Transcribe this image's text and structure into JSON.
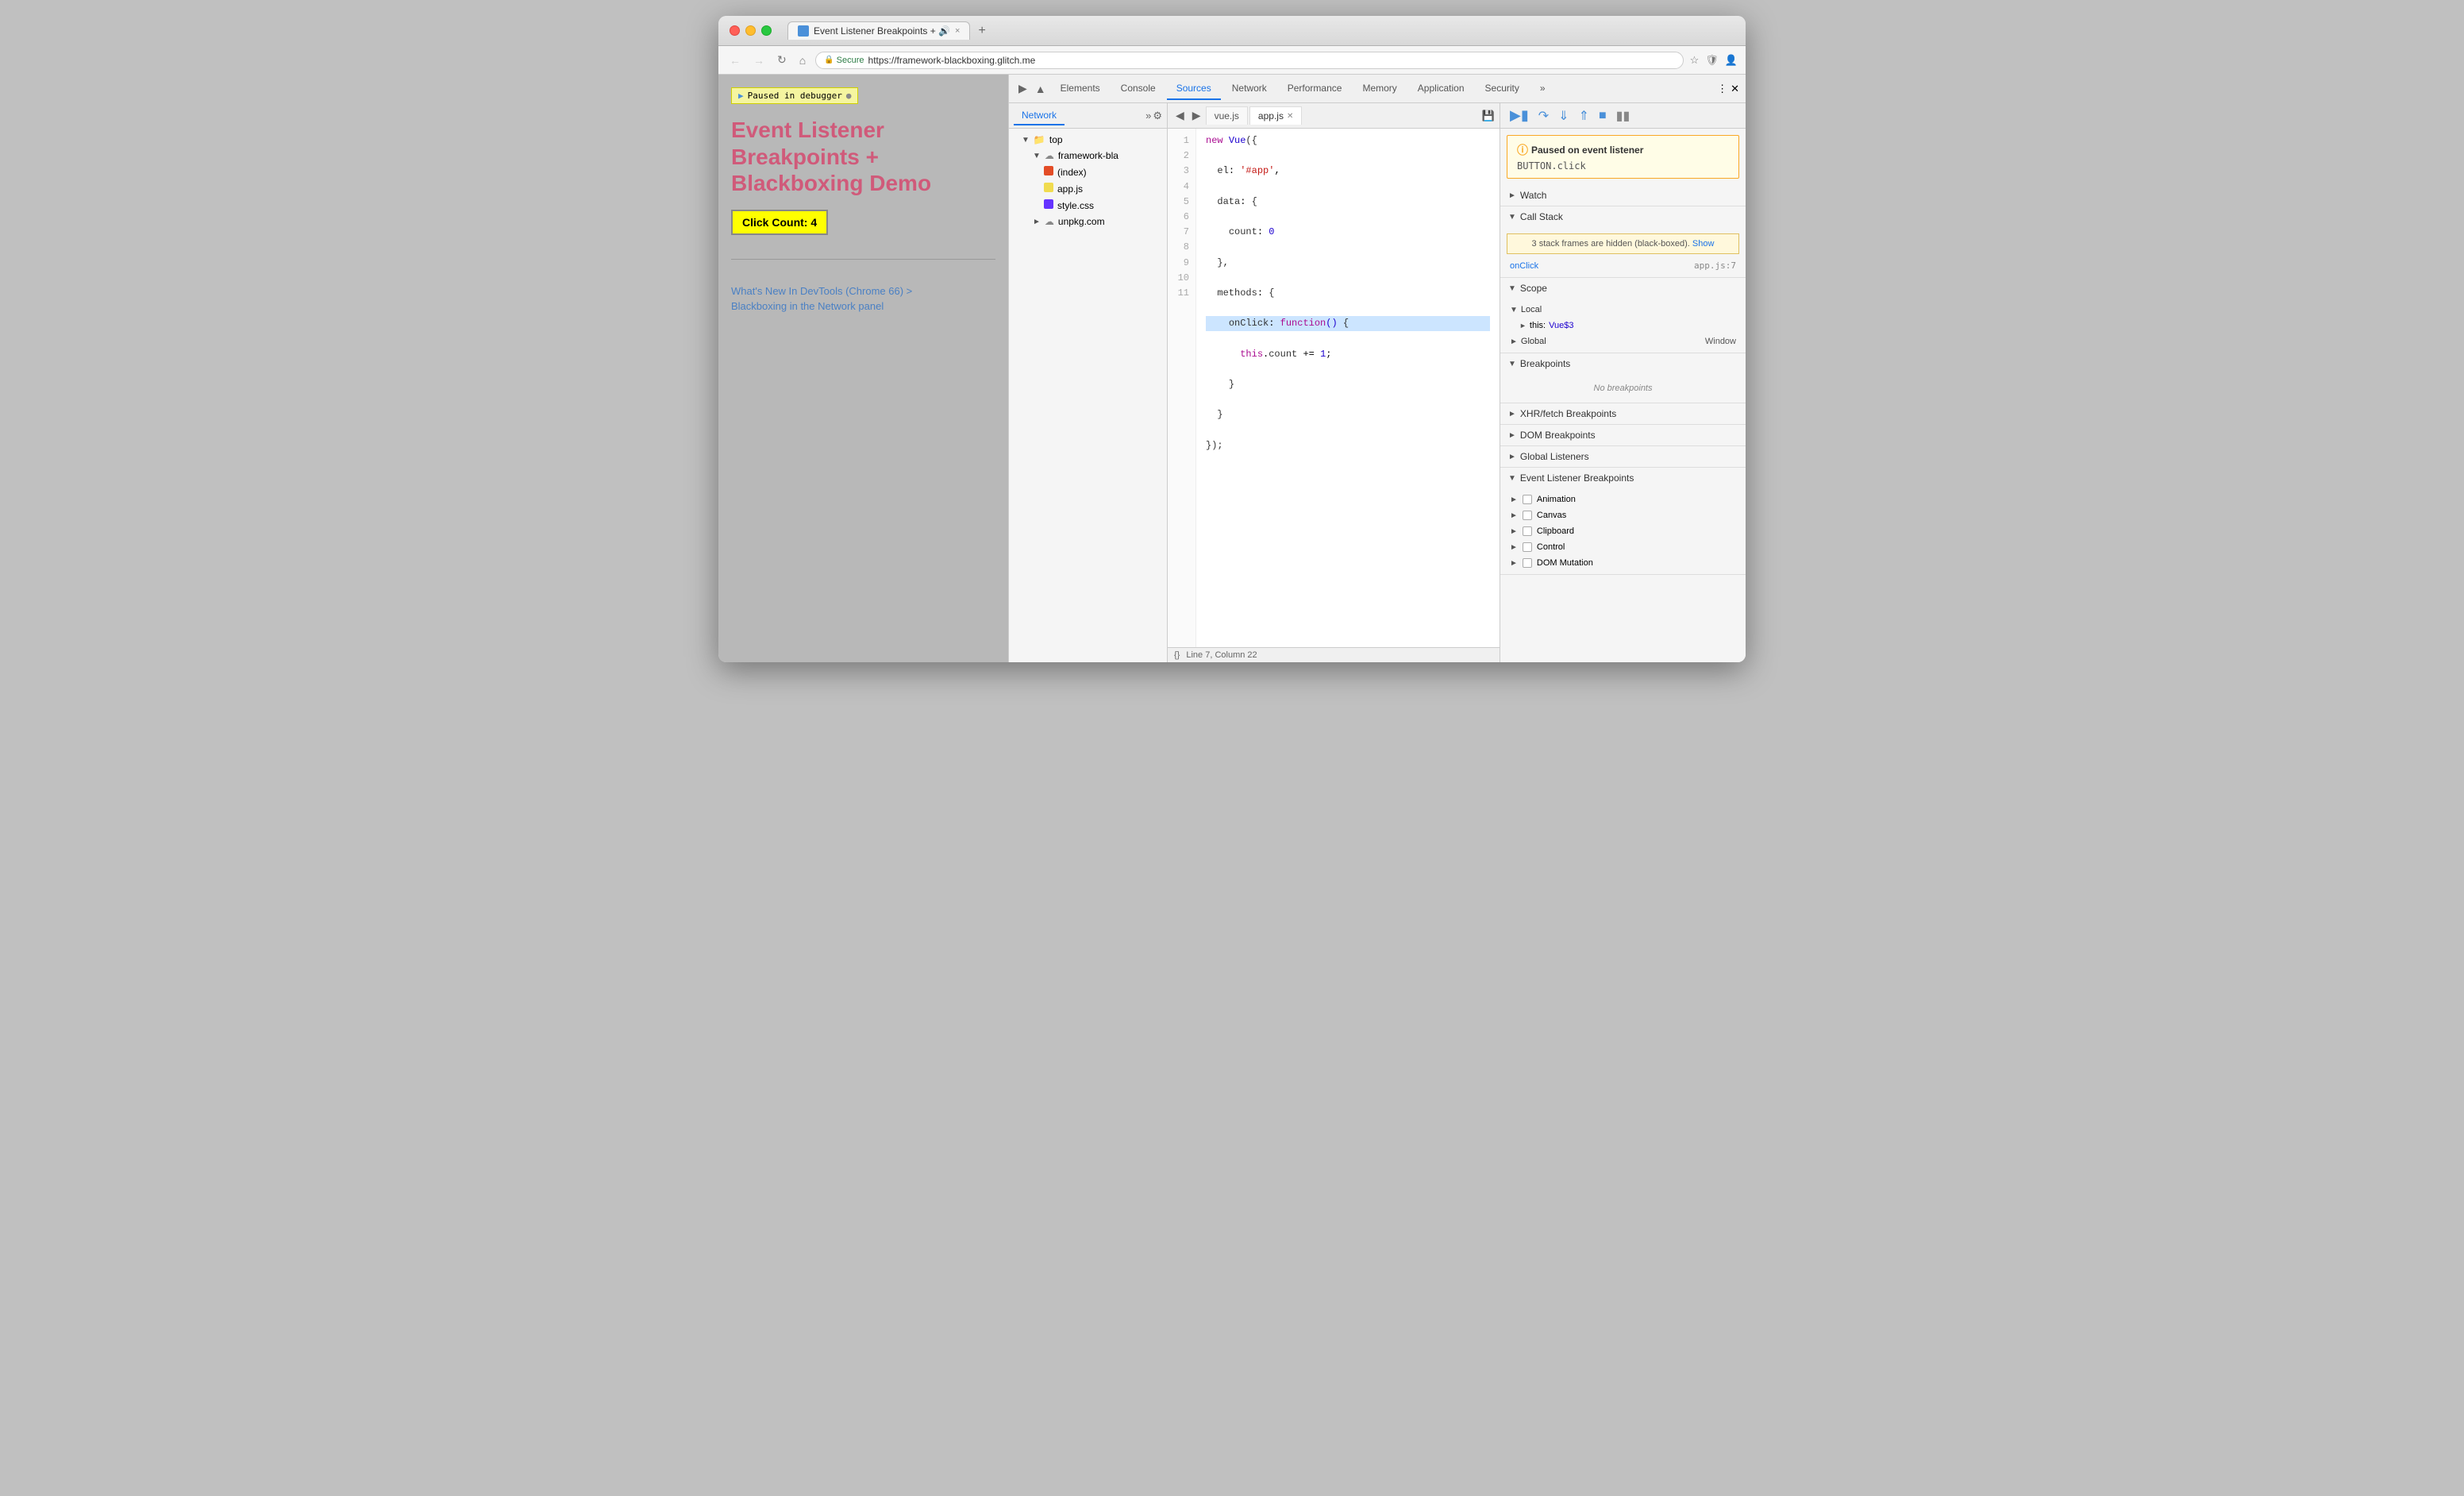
{
  "browser": {
    "tab_title": "Event Listener Breakpoints + 🔊",
    "tab_close": "×",
    "url_secure": "Secure",
    "url": "https://framework-blackboxing.glitch.me",
    "new_tab": "+"
  },
  "page_preview": {
    "paused_badge": "Paused in debugger",
    "title_line1": "Event Listener",
    "title_line2": "Breakpoints +",
    "title_line3": "Blackboxing Demo",
    "click_count": "Click Count: 4",
    "link1": "What's New In DevTools (Chrome 66) >",
    "link2": "Blackboxing in the Network panel"
  },
  "devtools": {
    "tabs": [
      "Elements",
      "Console",
      "Sources",
      "Network",
      "Performance",
      "Memory",
      "Application",
      "Security"
    ],
    "active_tab": "Sources"
  },
  "sources_sidebar": {
    "tabs": [
      "Network"
    ],
    "tree": [
      {
        "label": "top",
        "type": "root",
        "indent": 0
      },
      {
        "label": "framework-bla",
        "type": "cloud",
        "indent": 1
      },
      {
        "label": "(index)",
        "type": "html",
        "indent": 2
      },
      {
        "label": "app.js",
        "type": "js",
        "indent": 2
      },
      {
        "label": "style.css",
        "type": "css",
        "indent": 2
      },
      {
        "label": "unpkg.com",
        "type": "cloud",
        "indent": 1
      }
    ]
  },
  "editor": {
    "tabs": [
      "vue.js",
      "app.js"
    ],
    "active_tab": "app.js",
    "code_lines": [
      {
        "n": 1,
        "code": "new Vue({"
      },
      {
        "n": 2,
        "code": "  el: '#app',"
      },
      {
        "n": 3,
        "code": "  data: {"
      },
      {
        "n": 4,
        "code": "    count: 0"
      },
      {
        "n": 5,
        "code": "  },"
      },
      {
        "n": 6,
        "code": "  methods: {"
      },
      {
        "n": 7,
        "code": "    onClick: function() {",
        "active": true
      },
      {
        "n": 8,
        "code": "      this.count += 1;"
      },
      {
        "n": 9,
        "code": "    }"
      },
      {
        "n": 10,
        "code": "  }"
      },
      {
        "n": 11,
        "code": "});"
      }
    ],
    "status_bar": "Line 7, Column 22",
    "pretty_print": "{}"
  },
  "right_panel": {
    "paused_notice_title": "Paused on event listener",
    "paused_notice_detail": "BUTTON.click",
    "sections": {
      "watch_label": "Watch",
      "callstack_label": "Call Stack",
      "callstack_warning": "3 stack frames are hidden (black-boxed).",
      "callstack_warning_link": "Show",
      "stack_item_fn": "onClick",
      "stack_item_loc": "app.js:7",
      "scope_label": "Scope",
      "local_label": "Local",
      "this_val": "Vue$3",
      "global_label": "Global",
      "global_val": "Window",
      "breakpoints_label": "Breakpoints",
      "no_breakpoints": "No breakpoints",
      "xhr_label": "XHR/fetch Breakpoints",
      "dom_label": "DOM Breakpoints",
      "global_listeners_label": "Global Listeners",
      "event_listener_label": "Event Listener Breakpoints",
      "el_items": [
        "Animation",
        "Canvas",
        "Clipboard",
        "Control",
        "DOM Mutation"
      ]
    }
  }
}
